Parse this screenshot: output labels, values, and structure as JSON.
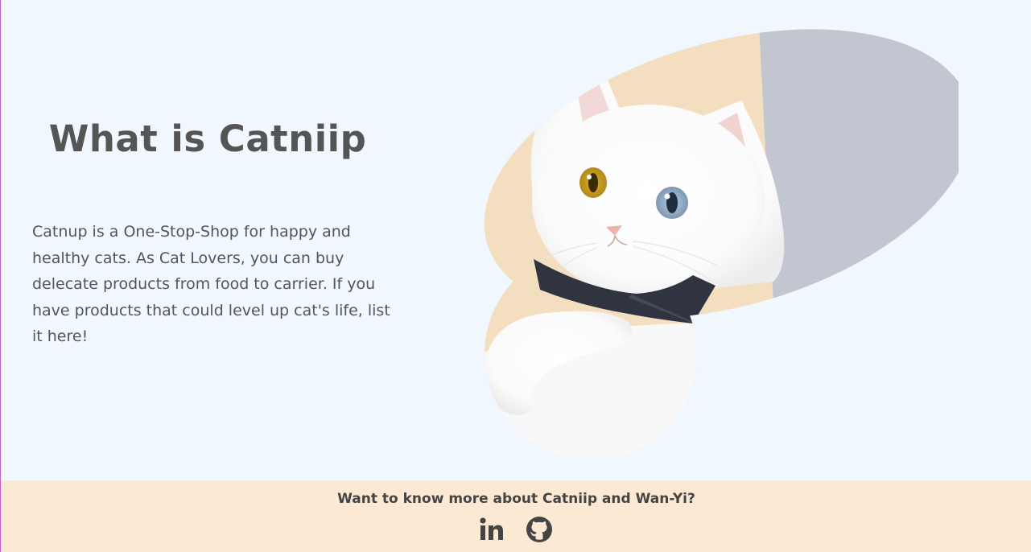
{
  "about": {
    "heading": "What is Catniip",
    "description": "Catnup is a One-Stop-Shop for happy and healthy cats. As Cat Lovers, you can buy delecate products from food to carrier. If you have products that could level up cat's life, list it here!"
  },
  "hero_image": {
    "subject": "white-cat-with-bow-tie",
    "colors": {
      "left_backdrop": "#f3dfbf",
      "right_backdrop": "#c2c6d0",
      "cat_fur": "#ffffff",
      "bow_tie": "#2f3440"
    }
  },
  "footer": {
    "text": "Want to know more about Catniip and Wan-Yi?",
    "background": "#fbe9d4",
    "links": [
      {
        "icon": "linkedin-icon"
      },
      {
        "icon": "github-icon"
      }
    ]
  },
  "colors": {
    "page_background": "#f0f7ff",
    "text": "#555555"
  }
}
